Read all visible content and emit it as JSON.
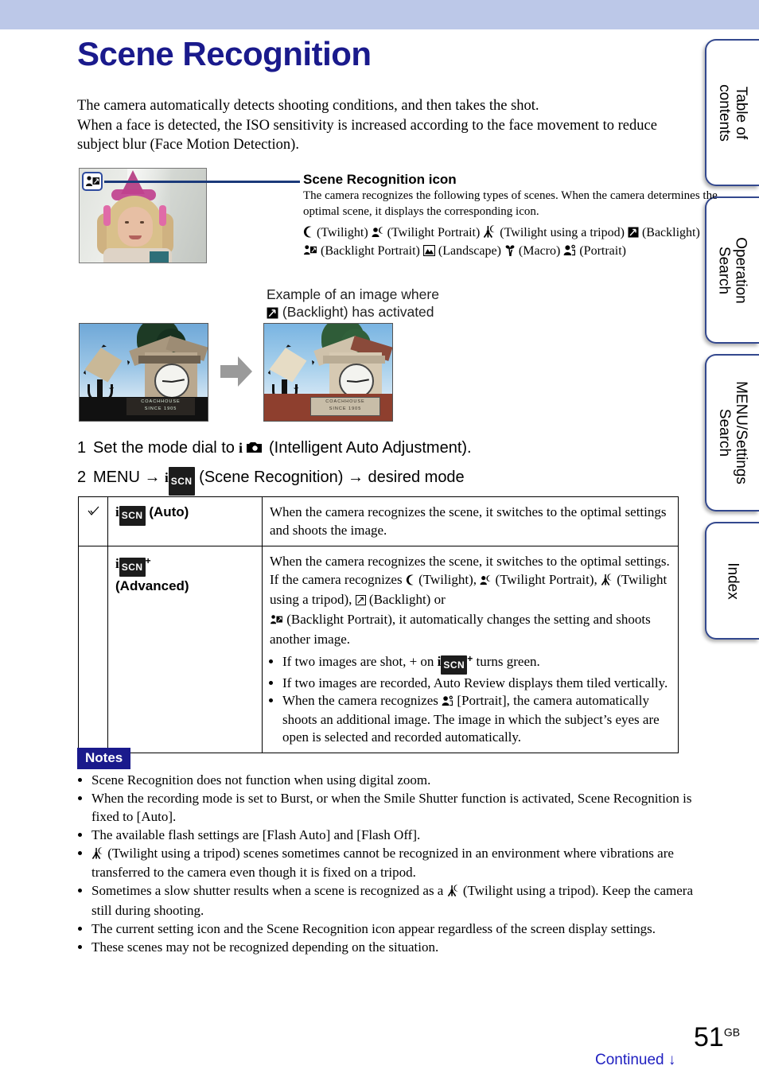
{
  "document": {
    "title": "Scene Recognition",
    "page_number": "51",
    "page_region": "GB",
    "continued_label": "Continued",
    "continued_arrow": "↓"
  },
  "colors": {
    "header_band": "#bcc8e8",
    "title": "#1a1a8c",
    "tab_border": "#33488e",
    "notes_badge_bg": "#1a1a8c",
    "callout_line": "#1b3a7a",
    "continued_text": "#1f1fc0"
  },
  "tabs": [
    {
      "label": "Table of\ncontents"
    },
    {
      "label": "Operation\nSearch"
    },
    {
      "label": "MENU/Settings\nSearch"
    },
    {
      "label": "Index"
    }
  ],
  "intro": {
    "line1": "The camera automatically detects shooting conditions, and then takes the shot.",
    "line2": "When a face is detected, the ISO sensitivity is increased according to the face movement to reduce subject blur (Face Motion Detection)."
  },
  "callout": {
    "heading": "Scene Recognition icon",
    "body": "The camera recognizes the following types of scenes. When the camera determines the optimal scene, it displays the corresponding icon.",
    "badge_icon": "backlight-portrait-icon"
  },
  "scene_types": [
    {
      "icon": "twilight-icon",
      "label": "(Twilight)"
    },
    {
      "icon": "twilight-portrait-icon",
      "label": "(Twilight Portrait)"
    },
    {
      "icon": "twilight-tripod-icon",
      "label": "(Twilight using a tripod)"
    },
    {
      "icon": "backlight-icon",
      "label": "(Backlight)"
    },
    {
      "icon": "backlight-portrait-icon",
      "label": "(Backlight Portrait)"
    },
    {
      "icon": "landscape-icon",
      "label": "(Landscape)"
    },
    {
      "icon": "macro-icon",
      "label": "(Macro)"
    },
    {
      "icon": "portrait-icon",
      "label": "(Portrait)"
    }
  ],
  "example": {
    "caption_line1": "Example of an image where",
    "caption_line2": "(Backlight) has activated",
    "image_before_alt": "clock tower photo before backlight correction",
    "image_after_alt": "clock tower photo after backlight correction",
    "sign_line1": "COACHHOUSE",
    "sign_line2": "SINCE 1905",
    "arrow_icon": "right-arrow-icon"
  },
  "steps": [
    {
      "num": "1",
      "text_before": "Set the mode dial to",
      "icon": "intelligent-auto-icon",
      "text_after": "(Intelligent Auto Adjustment)."
    },
    {
      "num": "2",
      "text_before": "MENU",
      "arrow1": "→",
      "icon": "i-scn-icon",
      "text_mid": "(Scene Recognition)",
      "arrow2": "→",
      "text_after": "desired mode"
    }
  ],
  "modes_table": {
    "rows": [
      {
        "default_marked": true,
        "check_icon": "check-icon",
        "icon": "i-scn-icon",
        "name": "(Auto)",
        "description": "When the camera recognizes the scene, it switches to the optimal settings and shoots the image.",
        "bullets": []
      },
      {
        "default_marked": false,
        "check_icon": "",
        "icon": "i-scn-plus-icon",
        "name": "(Advanced)",
        "description_part1": "When the camera recognizes the scene, it switches to the optimal settings. If the camera recognizes",
        "desc_twilight": "(Twilight),",
        "desc_twilight_portrait": "(Twilight Portrait),",
        "desc_twilight_tripod": "(Twilight using a tripod),",
        "desc_backlight": "(Backlight) or",
        "desc_backlight_portrait": "(Backlight Portrait), it automatically changes the setting and shoots another image.",
        "bullets": [
          {
            "text_before": "If two images are shot, + on",
            "icon": "i-scn-plus-icon",
            "text_after": "turns green."
          },
          {
            "text_before": "If two images are recorded, Auto Review displays them tiled vertically.",
            "icon": "",
            "text_after": ""
          },
          {
            "text_before": "When the camera recognizes",
            "icon": "portrait-icon",
            "text_after": "[Portrait], the camera automatically shoots an additional image. The image in which the subject’s eyes are open is selected and recorded automatically."
          }
        ]
      }
    ]
  },
  "notes": {
    "heading": "Notes",
    "items": [
      {
        "icon": "",
        "text": "Scene Recognition does not function when using digital zoom."
      },
      {
        "icon": "",
        "text": "When the recording mode is set to Burst, or when the Smile Shutter function is activated, Scene Recognition is fixed to [Auto]."
      },
      {
        "icon": "",
        "text": "The available flash settings are [Flash Auto] and [Flash Off]."
      },
      {
        "icon": "twilight-tripod-icon",
        "text": "(Twilight using a tripod) scenes sometimes cannot be recognized in an environment where vibrations are transferred to the camera even though it is fixed on a tripod."
      },
      {
        "icon": "",
        "text_before": "Sometimes a slow shutter results when a scene is recognized as a",
        "icon_mid": "twilight-tripod-icon",
        "text": "(Twilight using a tripod). Keep the camera still during shooting."
      },
      {
        "icon": "",
        "text": "The current setting icon and the Scene Recognition icon appear regardless of the screen display settings."
      },
      {
        "icon": "",
        "text": "These scenes may not be recognized depending on the situation."
      }
    ]
  }
}
